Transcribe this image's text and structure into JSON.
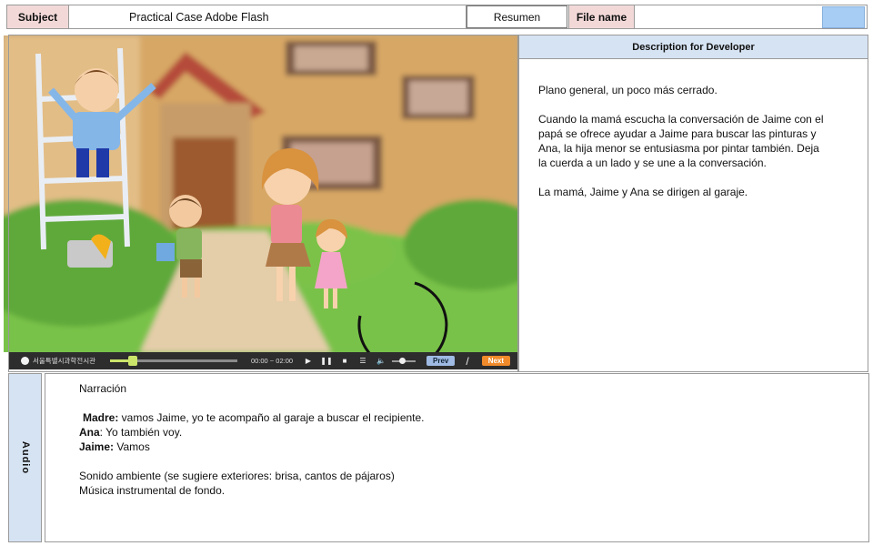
{
  "header": {
    "subject_label": "Subject",
    "subject_value": "Practical Case Adobe Flash",
    "resumen_button": "Resumen",
    "file_name_label": "File name",
    "file_name_value": ""
  },
  "description": {
    "title": "Description for Developer",
    "paragraphs": [
      "Plano general,  un poco más cerrado.",
      "Cuando  la mamá escucha la conversación de Jaime con el papá se ofrece ayudar a Jaime para buscar las pinturas y Ana, la hija menor se entusiasma por pintar también. Deja la cuerda  a un lado y se une a la conversación.",
      "La mamá, Jaime y Ana se dirigen al garaje."
    ]
  },
  "player": {
    "logo_text": "서울특별시과학전시관",
    "time": "00:00 ~ 02:00",
    "play_icon": "play-icon",
    "pause_icon": "pause-icon",
    "stop_icon": "stop-icon",
    "menu_icon": "menu-icon",
    "volume_icon": "volume-icon",
    "prev_label": "Prev",
    "separator": "/",
    "next_label": "Next",
    "progress": 0.18
  },
  "audio": {
    "side_label": "Audio",
    "narration_title": "Narración",
    "lines": [
      {
        "speaker": "Madre:",
        "text": " vamos Jaime, yo te acompaño al garaje a buscar el recipiente."
      },
      {
        "speaker": "Ana",
        "text": ": Yo también voy."
      },
      {
        "speaker": "Jaime:",
        "text": " Vamos"
      }
    ],
    "ambient": "Sonido ambiente (se sugiere exteriores: brisa, cantos de pájaros)",
    "music": "Música instrumental  de fondo."
  },
  "colors": {
    "header_label_bg": "#f2d9d8",
    "panel_header_bg": "#d6e3f3",
    "file_name_box": "#a8cdf4",
    "next_button": "#f08a2a",
    "prev_button": "#9fbbe4",
    "progress_fill": "#cbe56a"
  }
}
